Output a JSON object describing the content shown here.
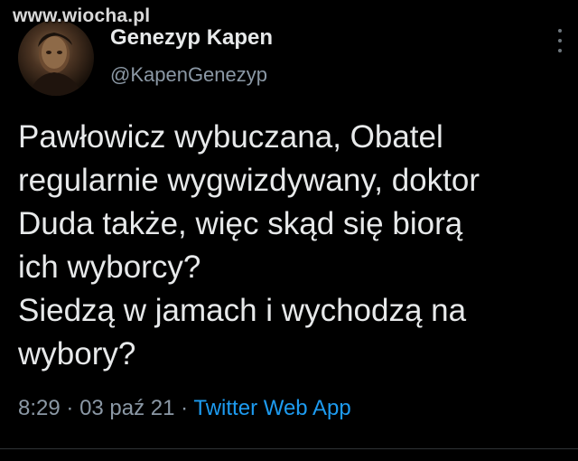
{
  "watermark": "www.wiocha.pl",
  "author": {
    "display_name": "Genezyp Kapen",
    "handle": "@KapenGenezyp",
    "avatar_icon": "profile-photo"
  },
  "tweet": {
    "lines": [
      "Pawłowicz wybuczana, Obatel",
      "regularnie wygwizdywany, doktor",
      "Duda także, więc skąd się biorą",
      "ich wyborcy?",
      "Siedzą w jamach i wychodzą na",
      "wybory?"
    ]
  },
  "meta": {
    "time": "8:29",
    "date": "03 paź 21",
    "separator": "·",
    "source": "Twitter Web App"
  },
  "icons": {
    "more": "more-options-icon"
  },
  "colors": {
    "background": "#000000",
    "text": "#e7e9ea",
    "secondary": "#8b98a5",
    "link": "#1d9bf0"
  }
}
